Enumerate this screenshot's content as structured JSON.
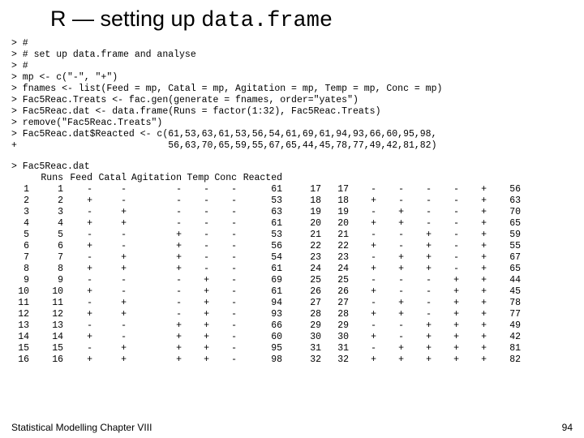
{
  "title": {
    "prefix": "R — setting up ",
    "code": "data.frame"
  },
  "code_lines": [
    "> #",
    "> # set up data.frame and analyse",
    "> #",
    "> mp <- c(\"-\", \"+\")",
    "> fnames <- list(Feed = mp, Catal = mp, Agitation = mp, Temp = mp, Conc = mp)",
    "> Fac5Reac.Treats <- fac.gen(generate = fnames, order=\"yates\")",
    "> Fac5Reac.dat <- data.frame(Runs = factor(1:32), Fac5Reac.Treats)",
    "> remove(\"Fac5Reac.Treats\")",
    "> Fac5Reac.dat$Reacted <- c(61,53,63,61,53,56,54,61,69,61,94,93,66,60,95,98,",
    "+                           56,63,70,65,59,55,67,65,44,45,78,77,49,42,81,82)"
  ],
  "table": {
    "cmd": "> Fac5Reac.dat",
    "head_idx": "",
    "head": {
      "runs": "Runs",
      "feed": "Feed",
      "catal": "Catal",
      "agit": "Agitation",
      "temp": "Temp",
      "conc": "Conc",
      "react": "Reacted"
    },
    "rows": [
      {
        "idx": "1",
        "runs": "1",
        "feed": "-",
        "catal": "-",
        "agit": "-",
        "temp": "-",
        "conc": "-",
        "react": "61",
        "x1": "17",
        "x2": "17",
        "s1": "-",
        "s2": "-",
        "s3": "-",
        "s4": "-",
        "s5": "+",
        "last": "56"
      },
      {
        "idx": "2",
        "runs": "2",
        "feed": "+",
        "catal": "-",
        "agit": "-",
        "temp": "-",
        "conc": "-",
        "react": "53",
        "x1": "18",
        "x2": "18",
        "s1": "+",
        "s2": "-",
        "s3": "-",
        "s4": "-",
        "s5": "+",
        "last": "63"
      },
      {
        "idx": "3",
        "runs": "3",
        "feed": "-",
        "catal": "+",
        "agit": "-",
        "temp": "-",
        "conc": "-",
        "react": "63",
        "x1": "19",
        "x2": "19",
        "s1": "-",
        "s2": "+",
        "s3": "-",
        "s4": "-",
        "s5": "+",
        "last": "70"
      },
      {
        "idx": "4",
        "runs": "4",
        "feed": "+",
        "catal": "+",
        "agit": "-",
        "temp": "-",
        "conc": "-",
        "react": "61",
        "x1": "20",
        "x2": "20",
        "s1": "+",
        "s2": "+",
        "s3": "-",
        "s4": "-",
        "s5": "+",
        "last": "65"
      },
      {
        "idx": "5",
        "runs": "5",
        "feed": "-",
        "catal": "-",
        "agit": "+",
        "temp": "-",
        "conc": "-",
        "react": "53",
        "x1": "21",
        "x2": "21",
        "s1": "-",
        "s2": "-",
        "s3": "+",
        "s4": "-",
        "s5": "+",
        "last": "59"
      },
      {
        "idx": "6",
        "runs": "6",
        "feed": "+",
        "catal": "-",
        "agit": "+",
        "temp": "-",
        "conc": "-",
        "react": "56",
        "x1": "22",
        "x2": "22",
        "s1": "+",
        "s2": "-",
        "s3": "+",
        "s4": "-",
        "s5": "+",
        "last": "55"
      },
      {
        "idx": "7",
        "runs": "7",
        "feed": "-",
        "catal": "+",
        "agit": "+",
        "temp": "-",
        "conc": "-",
        "react": "54",
        "x1": "23",
        "x2": "23",
        "s1": "-",
        "s2": "+",
        "s3": "+",
        "s4": "-",
        "s5": "+",
        "last": "67"
      },
      {
        "idx": "8",
        "runs": "8",
        "feed": "+",
        "catal": "+",
        "agit": "+",
        "temp": "-",
        "conc": "-",
        "react": "61",
        "x1": "24",
        "x2": "24",
        "s1": "+",
        "s2": "+",
        "s3": "+",
        "s4": "-",
        "s5": "+",
        "last": "65"
      },
      {
        "idx": "9",
        "runs": "9",
        "feed": "-",
        "catal": "-",
        "agit": "-",
        "temp": "+",
        "conc": "-",
        "react": "69",
        "x1": "25",
        "x2": "25",
        "s1": "-",
        "s2": "-",
        "s3": "-",
        "s4": "+",
        "s5": "+",
        "last": "44"
      },
      {
        "idx": "10",
        "runs": "10",
        "feed": "+",
        "catal": "-",
        "agit": "-",
        "temp": "+",
        "conc": "-",
        "react": "61",
        "x1": "26",
        "x2": "26",
        "s1": "+",
        "s2": "-",
        "s3": "-",
        "s4": "+",
        "s5": "+",
        "last": "45"
      },
      {
        "idx": "11",
        "runs": "11",
        "feed": "-",
        "catal": "+",
        "agit": "-",
        "temp": "+",
        "conc": "-",
        "react": "94",
        "x1": "27",
        "x2": "27",
        "s1": "-",
        "s2": "+",
        "s3": "-",
        "s4": "+",
        "s5": "+",
        "last": "78"
      },
      {
        "idx": "12",
        "runs": "12",
        "feed": "+",
        "catal": "+",
        "agit": "-",
        "temp": "+",
        "conc": "-",
        "react": "93",
        "x1": "28",
        "x2": "28",
        "s1": "+",
        "s2": "+",
        "s3": "-",
        "s4": "+",
        "s5": "+",
        "last": "77"
      },
      {
        "idx": "13",
        "runs": "13",
        "feed": "-",
        "catal": "-",
        "agit": "+",
        "temp": "+",
        "conc": "-",
        "react": "66",
        "x1": "29",
        "x2": "29",
        "s1": "-",
        "s2": "-",
        "s3": "+",
        "s4": "+",
        "s5": "+",
        "last": "49"
      },
      {
        "idx": "14",
        "runs": "14",
        "feed": "+",
        "catal": "-",
        "agit": "+",
        "temp": "+",
        "conc": "-",
        "react": "60",
        "x1": "30",
        "x2": "30",
        "s1": "+",
        "s2": "-",
        "s3": "+",
        "s4": "+",
        "s5": "+",
        "last": "42"
      },
      {
        "idx": "15",
        "runs": "15",
        "feed": "-",
        "catal": "+",
        "agit": "+",
        "temp": "+",
        "conc": "-",
        "react": "95",
        "x1": "31",
        "x2": "31",
        "s1": "-",
        "s2": "+",
        "s3": "+",
        "s4": "+",
        "s5": "+",
        "last": "81"
      },
      {
        "idx": "16",
        "runs": "16",
        "feed": "+",
        "catal": "+",
        "agit": "+",
        "temp": "+",
        "conc": "-",
        "react": "98",
        "x1": "32",
        "x2": "32",
        "s1": "+",
        "s2": "+",
        "s3": "+",
        "s4": "+",
        "s5": "+",
        "last": "82"
      }
    ]
  },
  "footer": "Statistical Modelling   Chapter VIII",
  "pagenum": "94"
}
